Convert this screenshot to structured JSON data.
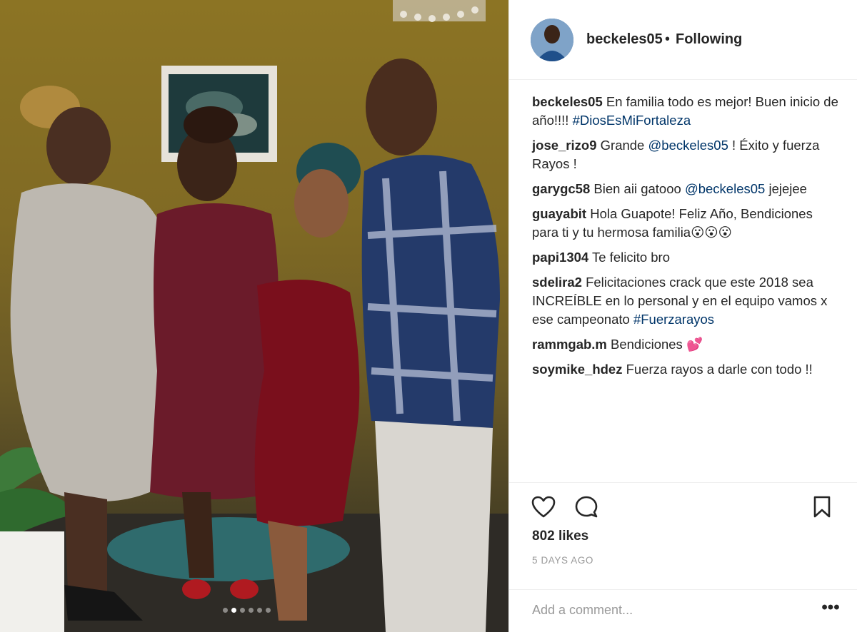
{
  "photo": {
    "description_icon": "post-photo",
    "carousel": {
      "count": 6,
      "active_index": 1
    }
  },
  "header": {
    "username": "beckeles05",
    "separator": "•",
    "follow_status": "Following"
  },
  "comments": [
    {
      "user": "beckeles05",
      "parts": [
        {
          "text": "En familia todo es mejor! Buen inicio de año!!!! "
        },
        {
          "text": "#DiosEsMiFortaleza",
          "link": true
        }
      ]
    },
    {
      "user": "jose_rizo9",
      "parts": [
        {
          "text": "Grande "
        },
        {
          "text": "@beckeles05",
          "link": true
        },
        {
          "text": " ! Éxito y fuerza Rayos !"
        }
      ]
    },
    {
      "user": "garygc58",
      "parts": [
        {
          "text": "Bien aii gatooo "
        },
        {
          "text": "@beckeles05",
          "link": true
        },
        {
          "text": " jejejee"
        }
      ]
    },
    {
      "user": "guayabit",
      "parts": [
        {
          "text": "Hola Guapote! Feliz Año, Bendiciones para ti y tu hermosa familia😮😮😮"
        }
      ]
    },
    {
      "user": "papi1304",
      "parts": [
        {
          "text": "Te felicito bro"
        }
      ]
    },
    {
      "user": "sdelira2",
      "parts": [
        {
          "text": "Felicitaciones crack que este 2018 sea INCREÍBLE en lo personal y en el equipo vamos x ese campeonato "
        },
        {
          "text": "#Fuerzarayos",
          "link": true
        }
      ]
    },
    {
      "user": "rammgab.m",
      "parts": [
        {
          "text": "Bendiciones 💕"
        }
      ]
    },
    {
      "user": "soymike_hdez",
      "parts": [
        {
          "text": "Fuerza rayos a darle con todo !!"
        }
      ]
    }
  ],
  "actions": {
    "like_icon": "heart-icon",
    "comment_icon": "comment-bubble-icon",
    "save_icon": "bookmark-icon",
    "likes": "802 likes",
    "date": "5 DAYS AGO"
  },
  "add_comment": {
    "placeholder": "Add a comment...",
    "more_label": "•••"
  },
  "colors": {
    "link": "#003569",
    "text": "#262626",
    "muted": "#999999",
    "border": "#efefef"
  }
}
